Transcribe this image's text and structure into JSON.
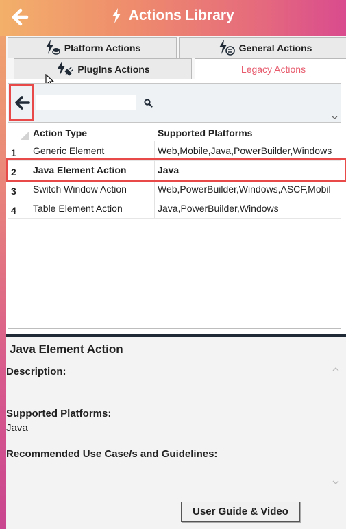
{
  "header": {
    "title": "Actions Library",
    "accent_color": "#e56a7d"
  },
  "tabs": {
    "platform": {
      "label": "Platform Actions",
      "icon": "platform-actions-icon"
    },
    "general": {
      "label": "General Actions",
      "icon": "general-actions-icon"
    },
    "plugins": {
      "label": "PlugIns Actions",
      "icon": "plugins-actions-icon"
    },
    "legacy": {
      "label": "Legacy Actions",
      "active": true,
      "color": "#e75b6d"
    }
  },
  "search": {
    "value": "",
    "placeholder": ""
  },
  "grid": {
    "columns": [
      "Action Type",
      "Supported Platforms"
    ],
    "rows": [
      {
        "num": "1",
        "type": "Generic Element",
        "platforms": "Web,Mobile,Java,PowerBuilder,Windows"
      },
      {
        "num": "2",
        "type": "Java Element Action",
        "platforms": "Java",
        "selected": true
      },
      {
        "num": "3",
        "type": "Switch Window Action",
        "platforms": "Web,PowerBuilder,Windows,ASCF,Mobil"
      },
      {
        "num": "4",
        "type": "Table Element Action",
        "platforms": "Java,PowerBuilder,Windows"
      }
    ]
  },
  "detail": {
    "title": "Java Element Action",
    "description_label": "Description:",
    "platforms_label": "Supported Platforms:",
    "platforms_value": "Java",
    "recommended_label": "Recommended Use Case/s and Guidelines:",
    "guide_button": "User Guide & Video"
  }
}
